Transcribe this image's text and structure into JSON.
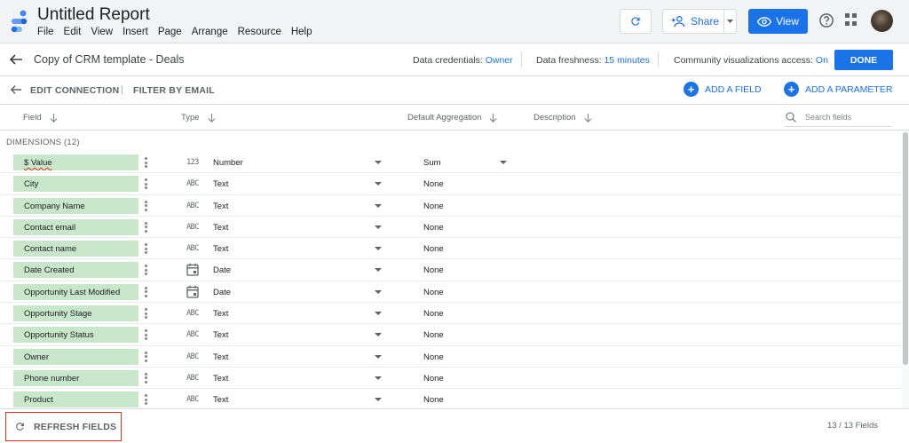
{
  "app": {
    "title": "Untitled Report",
    "menu": [
      "File",
      "Edit",
      "View",
      "Insert",
      "Page",
      "Arrange",
      "Resource",
      "Help"
    ],
    "share_label": "Share",
    "view_label": "View",
    "accent_color": "#1a73e8"
  },
  "datasource": {
    "name": "Copy of CRM template - Deals",
    "credentials_label": "Data credentials:",
    "credentials_value": "Owner",
    "freshness_label": "Data freshness:",
    "freshness_value": "15 minutes",
    "community_label": "Community visualizations access:",
    "community_value": "On",
    "done_label": "DONE"
  },
  "actions": {
    "edit_connection": "EDIT CONNECTION",
    "separator": "|",
    "filter_by_email": "FILTER BY EMAIL",
    "add_field": "ADD A FIELD",
    "add_parameter": "ADD A PARAMETER"
  },
  "columns": {
    "field": "Field",
    "type": "Type",
    "default_aggregation": "Default Aggregation",
    "description": "Description",
    "search_placeholder": "Search fields"
  },
  "section_label": "DIMENSIONS (12)",
  "rows": [
    {
      "name": "$ Value",
      "type_icon": "123",
      "type": "Number",
      "aggregation": "Sum",
      "agg_dropdown": true,
      "spellcheck": true
    },
    {
      "name": "City",
      "type_icon": "ABC",
      "type": "Text",
      "aggregation": "None"
    },
    {
      "name": "Company Name",
      "type_icon": "ABC",
      "type": "Text",
      "aggregation": "None"
    },
    {
      "name": "Contact email",
      "type_icon": "ABC",
      "type": "Text",
      "aggregation": "None"
    },
    {
      "name": "Contact name",
      "type_icon": "ABC",
      "type": "Text",
      "aggregation": "None"
    },
    {
      "name": "Date Created",
      "type_icon": "calendar",
      "type": "Date",
      "aggregation": "None"
    },
    {
      "name": "Opportunity Last Modified",
      "type_icon": "calendar",
      "type": "Date",
      "aggregation": "None"
    },
    {
      "name": "Opportunity Stage",
      "type_icon": "ABC",
      "type": "Text",
      "aggregation": "None"
    },
    {
      "name": "Opportunity Status",
      "type_icon": "ABC",
      "type": "Text",
      "aggregation": "None"
    },
    {
      "name": "Owner",
      "type_icon": "ABC",
      "type": "Text",
      "aggregation": "None"
    },
    {
      "name": "Phone number",
      "type_icon": "ABC",
      "type": "Text",
      "aggregation": "None"
    },
    {
      "name": "Product",
      "type_icon": "ABC",
      "type": "Text",
      "aggregation": "None"
    }
  ],
  "footer": {
    "refresh_label": "REFRESH FIELDS",
    "field_count": "13 / 13 Fields"
  }
}
